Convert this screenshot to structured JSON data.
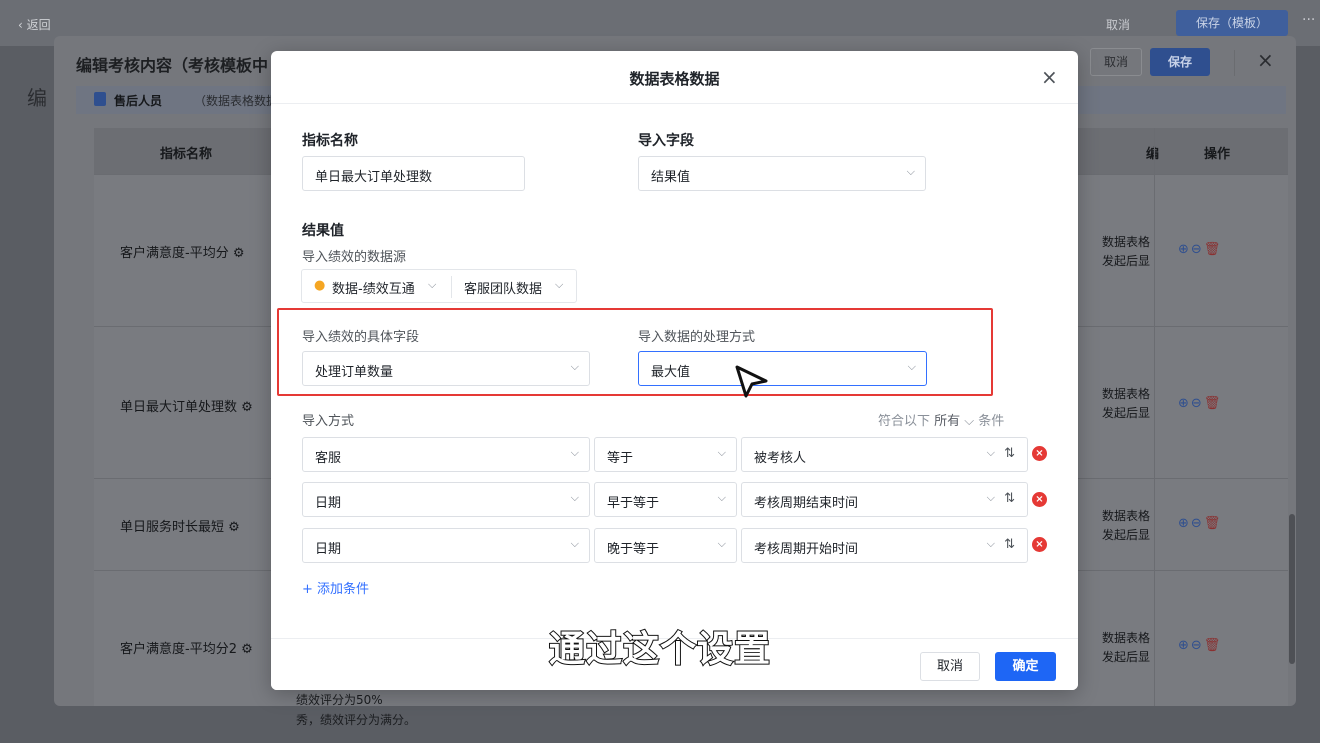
{
  "appbar": {
    "back_label": "返回",
    "cancel_label": "取消",
    "save_template_label": "保存（模板）",
    "more_label": "···"
  },
  "background": {
    "left_char": "编"
  },
  "panel": {
    "title": "编辑考核内容（考核模板中",
    "cancel_label": "取消",
    "save_label": "保存",
    "section_label": "售后人员",
    "section_sub": "（数据表格数据:",
    "columns": {
      "name": "指标名称",
      "desc_truncated": "编",
      "ops": "操作"
    },
    "rows": [
      {
        "name": "客户满意度-平均分 ⚙",
        "desc1": "数据表格",
        "desc2": "发起后显"
      },
      {
        "name": "单日最大订单处理数 ⚙",
        "desc1": "数据表格",
        "desc2": "发起后显"
      },
      {
        "name": "单日服务时长最短 ⚙",
        "desc1": "数据表格",
        "desc2": "发起后显"
      },
      {
        "name": "客户满意度-平均分2 ⚙",
        "desc1": "数据表格",
        "desc2": "发起后显"
      }
    ],
    "behind_text_1": "绩效评分为50%",
    "behind_text_2": "秀，绩效评分为满分。"
  },
  "modal": {
    "title": "数据表格数据",
    "indicator_name_label": "指标名称",
    "indicator_name_value": "单日最大订单处理数",
    "import_field_label": "导入字段",
    "import_field_value": "结果值",
    "result_title": "结果值",
    "datasource_label": "导入绩效的数据源",
    "datasource_primary": "数据-绩效互通",
    "datasource_secondary": "客服团队数据",
    "specific_field_label": "导入绩效的具体字段",
    "specific_field_value": "处理订单数量",
    "processing_label": "导入数据的处理方式",
    "processing_value": "最大值",
    "import_method_label": "导入方式",
    "match_prefix": "符合以下",
    "match_mode": "所有",
    "match_suffix": "条件",
    "conditions": [
      {
        "field": "客服",
        "operator": "等于",
        "value": "被考核人"
      },
      {
        "field": "日期",
        "operator": "早于等于",
        "value": "考核周期结束时间"
      },
      {
        "field": "日期",
        "operator": "晚于等于",
        "value": "考核周期开始时间"
      }
    ],
    "add_condition_label": "添加条件",
    "cancel_label": "取消",
    "ok_label": "确定"
  },
  "subtitle": "通过这个设置",
  "icons": {
    "close": "×",
    "chevron": "⌵",
    "swap": "⇅",
    "remove": "×",
    "plus": "+",
    "flame": "🔥"
  },
  "colors": {
    "primary": "#1e66f5",
    "highlight": "#e53935",
    "danger": "#e53935"
  }
}
